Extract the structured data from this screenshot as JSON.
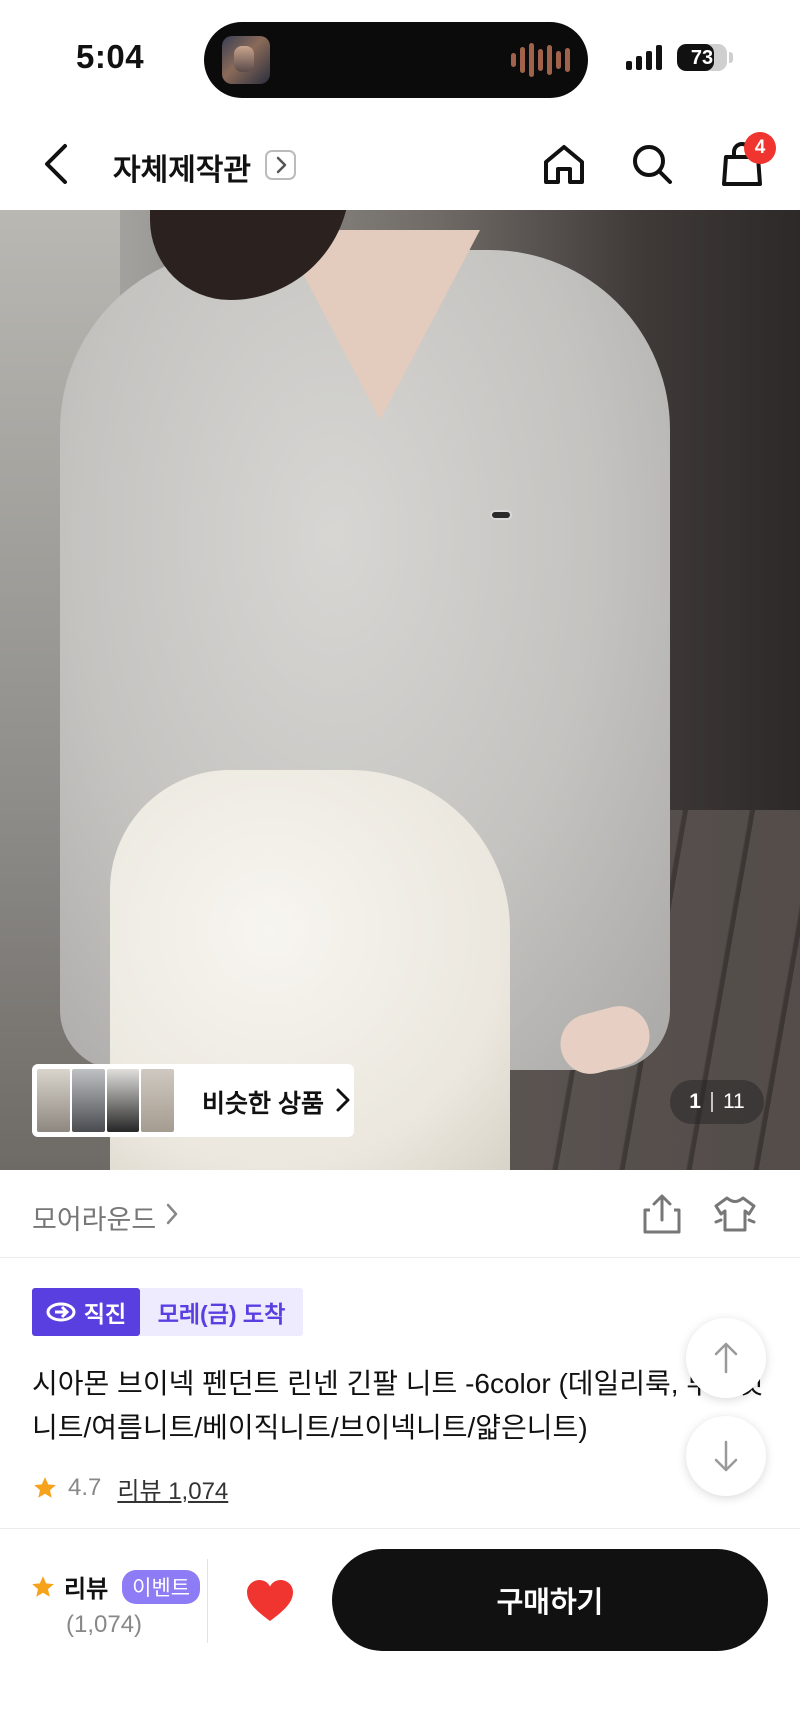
{
  "status_bar": {
    "time": "5:04",
    "battery": "73",
    "battery_level": 0.73
  },
  "header": {
    "store_name": "자체제작관",
    "cart_count": "4",
    "icons": [
      "back-icon",
      "chevron-right-icon",
      "home-icon",
      "search-icon",
      "shopping-bag-icon"
    ]
  },
  "gallery": {
    "similar_label": "비슷한 상품",
    "current_page": "1",
    "total_pages": "11"
  },
  "brand": {
    "name": "모어라운드"
  },
  "badges": {
    "direct_label": "직진",
    "arrival_label": "모레(금) 도착",
    "direct_color": "#5a3fe0"
  },
  "product": {
    "title": "시아몬 브이넥 펜던트 린넨 긴팔 니트 -6color (데일리룩, 루즈핏니트/여름니트/베이직니트/브이넥니트/얇은니트)",
    "rating": "4.7",
    "review_link": "리뷰 1,074"
  },
  "bottom_bar": {
    "review_label": "리뷰",
    "event_label": "이벤트",
    "review_count": "(1,074)",
    "buy_label": "구매하기",
    "heart_color": "#f0342f"
  }
}
